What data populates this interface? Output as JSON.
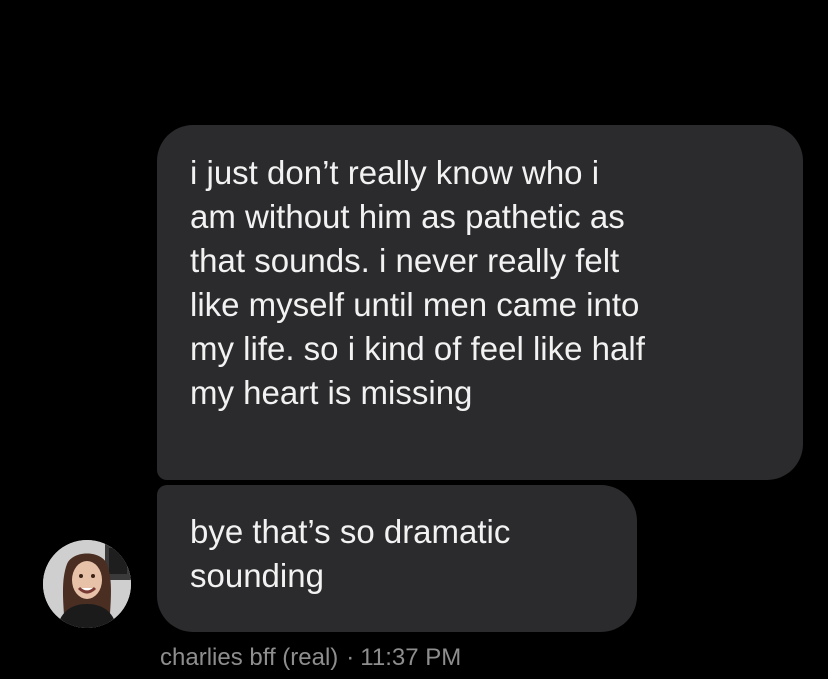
{
  "conversation": {
    "messages": [
      {
        "text": "i just don’t really know who i\nam without him as pathetic as\nthat sounds. i never really felt\nlike myself until men came into\nmy life. so i kind of feel like half\nmy heart is missing"
      },
      {
        "text": "bye that’s so dramatic\nsounding"
      }
    ],
    "sender": {
      "avatar_icon": "profile-photo-avatar",
      "name": "charlies bff (real)"
    },
    "separator": "·",
    "timestamp": "11:37 PM"
  },
  "colors": {
    "background": "#000000",
    "bubble": "#2b2b2d",
    "message_text": "#f2f2f2",
    "meta_text": "#8e8e8e"
  }
}
